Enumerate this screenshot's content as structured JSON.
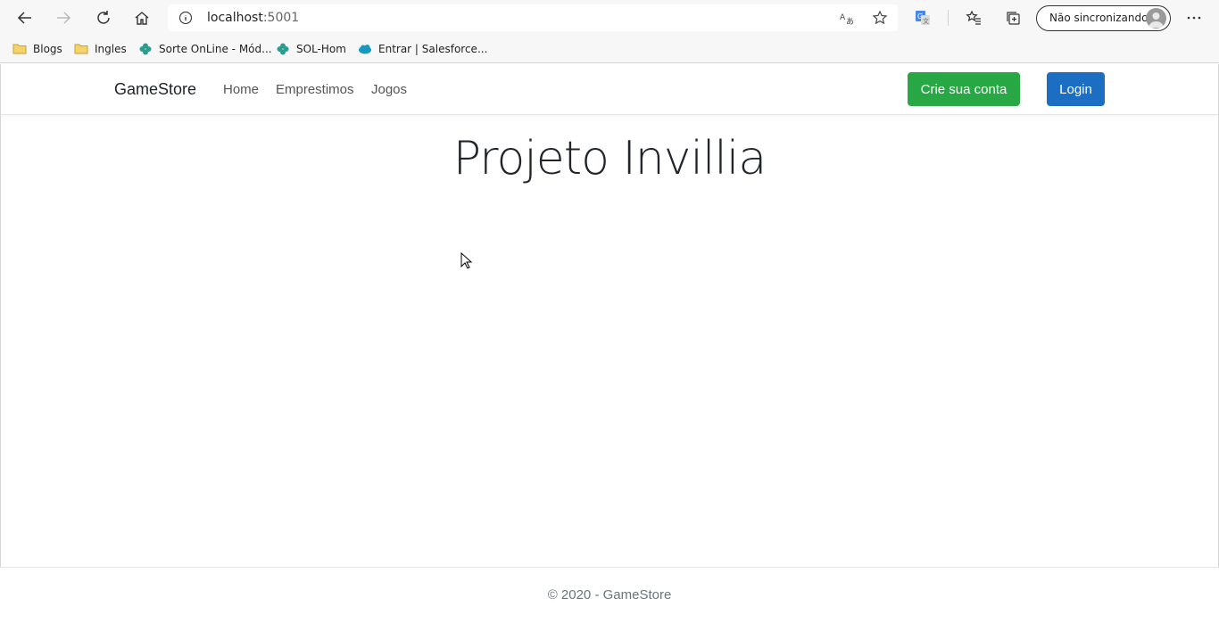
{
  "browser": {
    "url_host": "localhost",
    "url_port": ":5001",
    "profile_label": "Não sincronizando",
    "icons": {
      "back": "back-arrow-icon",
      "forward": "forward-arrow-icon",
      "refresh": "refresh-icon",
      "home": "home-icon",
      "info": "info-icon",
      "translate": "translate-icon",
      "favorite": "star-icon",
      "extension": "google-translate-icon",
      "favorites": "favorites-icon",
      "collections": "collections-icon",
      "more": "more-icon"
    },
    "bookmarks": [
      {
        "label": "Blogs",
        "icon": "folder-icon"
      },
      {
        "label": "Ingles",
        "icon": "folder-icon"
      },
      {
        "label": "Sorte OnLine - Mód...",
        "icon": "clover-icon"
      },
      {
        "label": "SOL-Hom",
        "icon": "clover-icon"
      },
      {
        "label": "Entrar | Salesforce...",
        "icon": "salesforce-cloud-icon"
      }
    ]
  },
  "navbar": {
    "brand": "GameStore",
    "links": [
      "Home",
      "Emprestimos",
      "Jogos"
    ],
    "signup_label": "Crie sua conta",
    "login_label": "Login"
  },
  "main": {
    "title": "Projeto Invillia"
  },
  "footer": {
    "text": "© 2020 - GameStore"
  },
  "colors": {
    "success": "#28a745",
    "primary": "#1b6ec2"
  }
}
